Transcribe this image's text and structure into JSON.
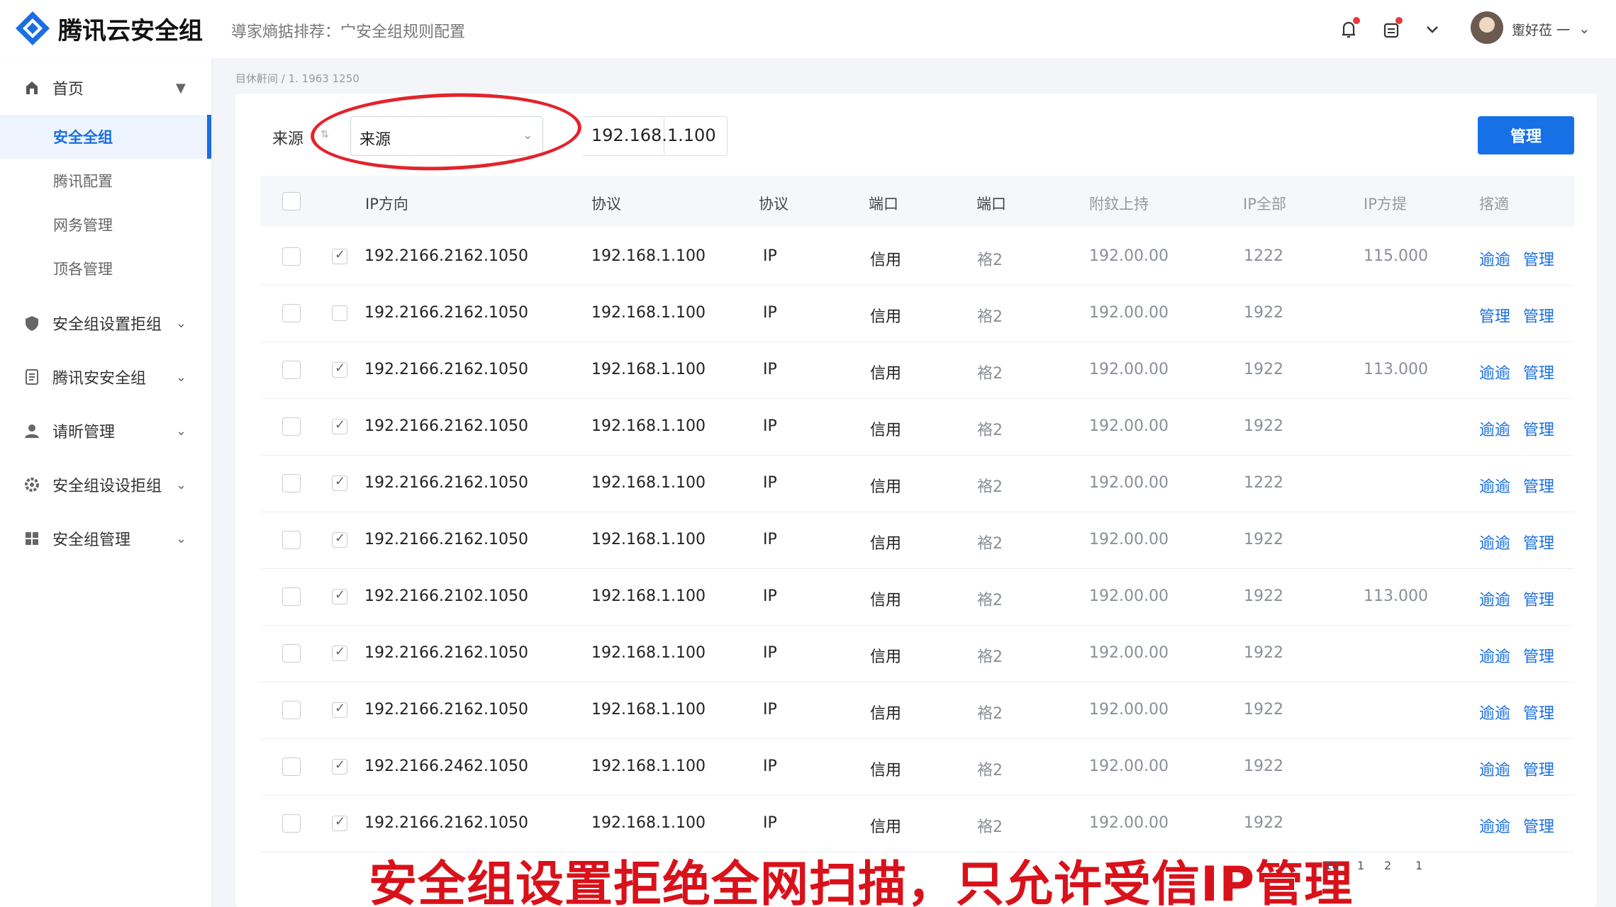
{
  "header": {
    "app_title": "腾讯云安全组",
    "subtitle": "導家熵掂排荐：宀安全组规则配置",
    "user_name": "躗好莅 一"
  },
  "sidebar": {
    "home": {
      "label": "首页"
    },
    "sub_items": [
      {
        "label": "安全全组",
        "active": true
      },
      {
        "label": "腾讯配置",
        "active": false
      },
      {
        "label": "网务管理",
        "active": false
      },
      {
        "label": "顶各管理",
        "active": false
      }
    ],
    "groups": [
      {
        "label": "安全组设置拒组",
        "icon": "shield-icon"
      },
      {
        "label": "腾讯安安全组",
        "icon": "document-icon"
      },
      {
        "label": "请昕管理",
        "icon": "user-icon"
      },
      {
        "label": "安全组设设拒组",
        "icon": "gear-icon"
      },
      {
        "label": "安全组管理",
        "icon": "grid-icon"
      }
    ]
  },
  "breadcrumb": "目休鼾间 / 1. 1963 1250",
  "filter": {
    "label": "来源",
    "select_value": "来源",
    "ip_value": "192.168.1.100"
  },
  "manage_button": "管理",
  "table": {
    "headers": [
      "IP方向",
      "协议",
      "协议",
      "端口",
      "端口",
      "附鈫上持",
      "IP全部",
      "IP方提",
      "揢適"
    ],
    "rows": [
      {
        "checked": true,
        "ip": "192.2166.2162.1050",
        "source": "192.168.1.100",
        "proto": "IP",
        "port": "信用",
        "port2": "袼2",
        "value": "192.00.00",
        "count": "1222",
        "extra": "115.000",
        "action1": "逾逾",
        "action2": "管理"
      },
      {
        "checked": false,
        "ip": "192.2166.2162.1050",
        "source": "192.168.1.100",
        "proto": "IP",
        "port": "信用",
        "port2": "袼2",
        "value": "192.00.00",
        "count": "1922",
        "extra": "",
        "action1": "管理",
        "action2": "管理"
      },
      {
        "checked": true,
        "ip": "192.2166.2162.1050",
        "source": "192.168.1.100",
        "proto": "IP",
        "port": "信用",
        "port2": "袼2",
        "value": "192.00.00",
        "count": "1922",
        "extra": "113.000",
        "action1": "逾逾",
        "action2": "管理"
      },
      {
        "checked": true,
        "ip": "192.2166.2162.1050",
        "source": "192.168.1.100",
        "proto": "IP",
        "port": "信用",
        "port2": "袼2",
        "value": "192.00.00",
        "count": "1922",
        "extra": "",
        "action1": "逾逾",
        "action2": "管理"
      },
      {
        "checked": true,
        "ip": "192.2166.2162.1050",
        "source": "192.168.1.100",
        "proto": "IP",
        "port": "信用",
        "port2": "袼2",
        "value": "192.00.00",
        "count": "1222",
        "extra": "",
        "action1": "逾逾",
        "action2": "管理"
      },
      {
        "checked": true,
        "ip": "192.2166.2162.1050",
        "source": "192.168.1.100",
        "proto": "IP",
        "port": "信用",
        "port2": "袼2",
        "value": "192.00.00",
        "count": "1922",
        "extra": "",
        "action1": "逾逾",
        "action2": "管理"
      },
      {
        "checked": true,
        "ip": "192.2166.2102.1050",
        "source": "192.168.1.100",
        "proto": "IP",
        "port": "信用",
        "port2": "袼2",
        "value": "192.00.00",
        "count": "1922",
        "extra": "113.000",
        "action1": "逾逾",
        "action2": "管理"
      },
      {
        "checked": true,
        "ip": "192.2166.2162.1050",
        "source": "192.168.1.100",
        "proto": "IP",
        "port": "信用",
        "port2": "袼2",
        "value": "192.00.00",
        "count": "1922",
        "extra": "",
        "action1": "逾逾",
        "action2": "管理"
      },
      {
        "checked": true,
        "ip": "192.2166.2162.1050",
        "source": "192.168.1.100",
        "proto": "IP",
        "port": "信用",
        "port2": "袼2",
        "value": "192.00.00",
        "count": "1922",
        "extra": "",
        "action1": "逾逾",
        "action2": "管理"
      },
      {
        "checked": true,
        "ip": "192.2166.2462.1050",
        "source": "192.168.1.100",
        "proto": "IP",
        "port": "信用",
        "port2": "袼2",
        "value": "192.00.00",
        "count": "1922",
        "extra": "",
        "action1": "逾逾",
        "action2": "管理"
      },
      {
        "checked": true,
        "ip": "192.2166.2162.1050",
        "source": "192.168.1.100",
        "proto": "IP",
        "port": "信用",
        "port2": "袼2",
        "value": "192.00.00",
        "count": "1922",
        "extra": "",
        "action1": "逾逾",
        "action2": "管理"
      }
    ]
  },
  "caption": "安全组设置拒绝全网扫描，只允许受信IP管理",
  "pagination": [
    "10",
    "1",
    "2",
    "1"
  ],
  "colors": {
    "accent": "#1670e6",
    "highlight": "#e3232b",
    "caption": "#d9111a"
  }
}
